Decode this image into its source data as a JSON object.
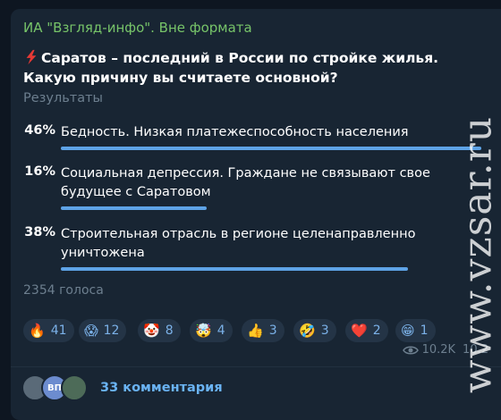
{
  "channel": {
    "name": "ИА \"Взгляд-инфо\". Вне формата"
  },
  "poll": {
    "question": "Саратов – последний в России по стройке жилья. Какую причину вы считаете основной?",
    "results_label": "Результаты",
    "options": [
      {
        "percent_label": "46%",
        "text": "Бедность. Низкая платежеспособность населения",
        "percent": 46
      },
      {
        "percent_label": "16%",
        "text": "Социальная депрессия. Граждане не связывают свое будущее с Саратовом",
        "percent": 16
      },
      {
        "percent_label": "38%",
        "text": "Строительная отрасль в регионе целенаправленно уничтожена",
        "percent": 38
      }
    ],
    "votes": "2354 голоса"
  },
  "reactions": [
    {
      "emoji": "🔥",
      "count": "41"
    },
    {
      "emoji": "😱",
      "count": "12"
    },
    {
      "emoji": "🤡",
      "count": "8"
    },
    {
      "emoji": "🤯",
      "count": "4"
    },
    {
      "emoji": "👍",
      "count": "3"
    },
    {
      "emoji": "🤣",
      "count": "3"
    },
    {
      "emoji": "❤️",
      "count": "2"
    },
    {
      "emoji": "😁",
      "count": "1"
    }
  ],
  "views": {
    "count": "10.2K",
    "extra": "10.2"
  },
  "comments": {
    "label": "33 комментария",
    "avatars": [
      "",
      "ВП",
      ""
    ]
  },
  "watermark": "www.vzsar.ru",
  "colors": {
    "bar": "#5ea3e6",
    "channel": "#77c469",
    "link": "#6ab3f3"
  }
}
